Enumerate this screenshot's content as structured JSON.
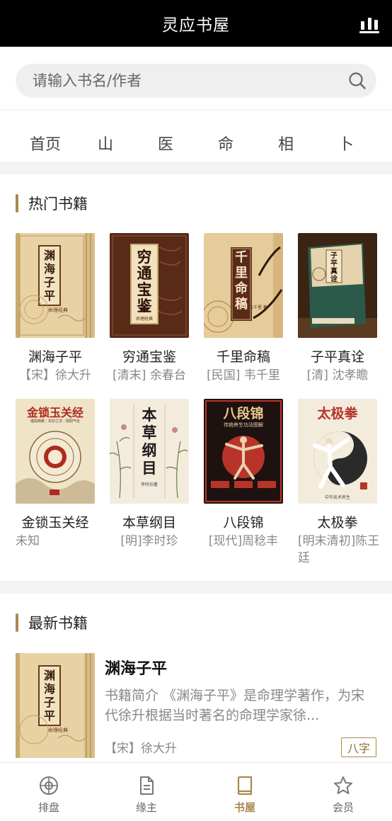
{
  "header": {
    "title": "灵应书屋",
    "stats_icon": "bar-chart-icon"
  },
  "search": {
    "placeholder": "请输入书名/作者",
    "icon": "search-icon"
  },
  "categories": [
    "首页",
    "山",
    "医",
    "命",
    "相",
    "卜"
  ],
  "hot": {
    "title": "热门书籍",
    "books": [
      {
        "title": "渊海子平",
        "author": "【宋】徐大升",
        "cover_text": "渊海子平",
        "cover_sub": "命理经典"
      },
      {
        "title": "穷通宝鉴",
        "author": "[清末] 余春台",
        "cover_text": "穷通宝鉴",
        "cover_sub": "命理经典"
      },
      {
        "title": "千里命稿",
        "author": "[民国] 韦千里",
        "cover_text": "千里命稿",
        "cover_sub": "韦千里 著"
      },
      {
        "title": "子平真诠",
        "author": "[清] 沈孝瞻",
        "cover_text": "子平真诠",
        "cover_sub": ""
      },
      {
        "title": "金锁玉关经",
        "author": "未知",
        "cover_text": "金锁玉关经",
        "cover_sub": "堪舆典籍｜玄妙之法｜阴阳气化"
      },
      {
        "title": "本草纲目",
        "author": "[明]李时珍",
        "cover_text": "本草纲目",
        "cover_sub": "李时珍著"
      },
      {
        "title": "八段锦",
        "author": "[现代]周稔丰",
        "cover_text": "八段锦",
        "cover_sub": "传统养生功法图解"
      },
      {
        "title": "太极拳",
        "author": "[明末清初]陈王廷",
        "cover_text": "太极拳",
        "cover_sub": "中华武术养生"
      }
    ]
  },
  "latest": {
    "title": "最新书籍",
    "book": {
      "title": "渊海子平",
      "desc": "书籍简介 《渊海子平》是命理学著作，为宋代徐升根据当时著名的命理学家徐...",
      "author": "【宋】徐大升",
      "tag": "八字",
      "cover_text": "渊海子平",
      "cover_sub": "命理经典"
    }
  },
  "tabs": [
    {
      "label": "排盘",
      "icon": "compass-icon",
      "active": false
    },
    {
      "label": "缘主",
      "icon": "document-icon",
      "active": false
    },
    {
      "label": "书屋",
      "icon": "book-icon",
      "active": true
    },
    {
      "label": "会员",
      "icon": "star-icon",
      "active": false
    }
  ],
  "colors": {
    "accent": "#a8894e",
    "header_bg": "#000000"
  }
}
